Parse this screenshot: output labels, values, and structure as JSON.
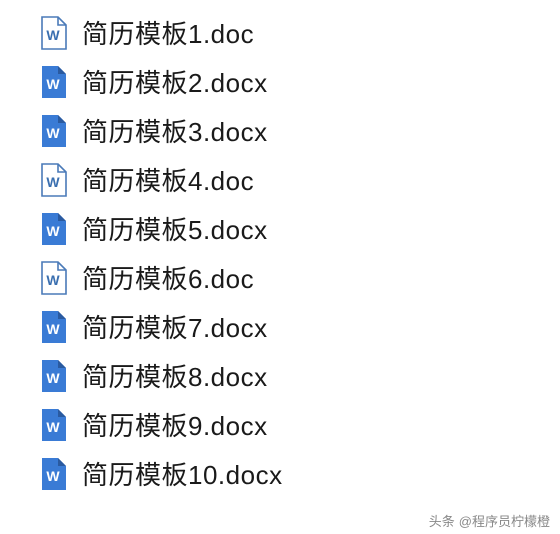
{
  "files": [
    {
      "name": "简历模板1.doc",
      "iconType": "doc"
    },
    {
      "name": "简历模板2.docx",
      "iconType": "docx"
    },
    {
      "name": "简历模板3.docx",
      "iconType": "docx"
    },
    {
      "name": "简历模板4.doc",
      "iconType": "doc"
    },
    {
      "name": "简历模板5.docx",
      "iconType": "docx"
    },
    {
      "name": "简历模板6.doc",
      "iconType": "doc"
    },
    {
      "name": "简历模板7.docx",
      "iconType": "docx"
    },
    {
      "name": "简历模板8.docx",
      "iconType": "docx"
    },
    {
      "name": "简历模板9.docx",
      "iconType": "docx"
    },
    {
      "name": "简历模板10.docx",
      "iconType": "docx"
    }
  ],
  "attribution": {
    "prefix": "头条",
    "author": "@程序员柠檬橙"
  }
}
